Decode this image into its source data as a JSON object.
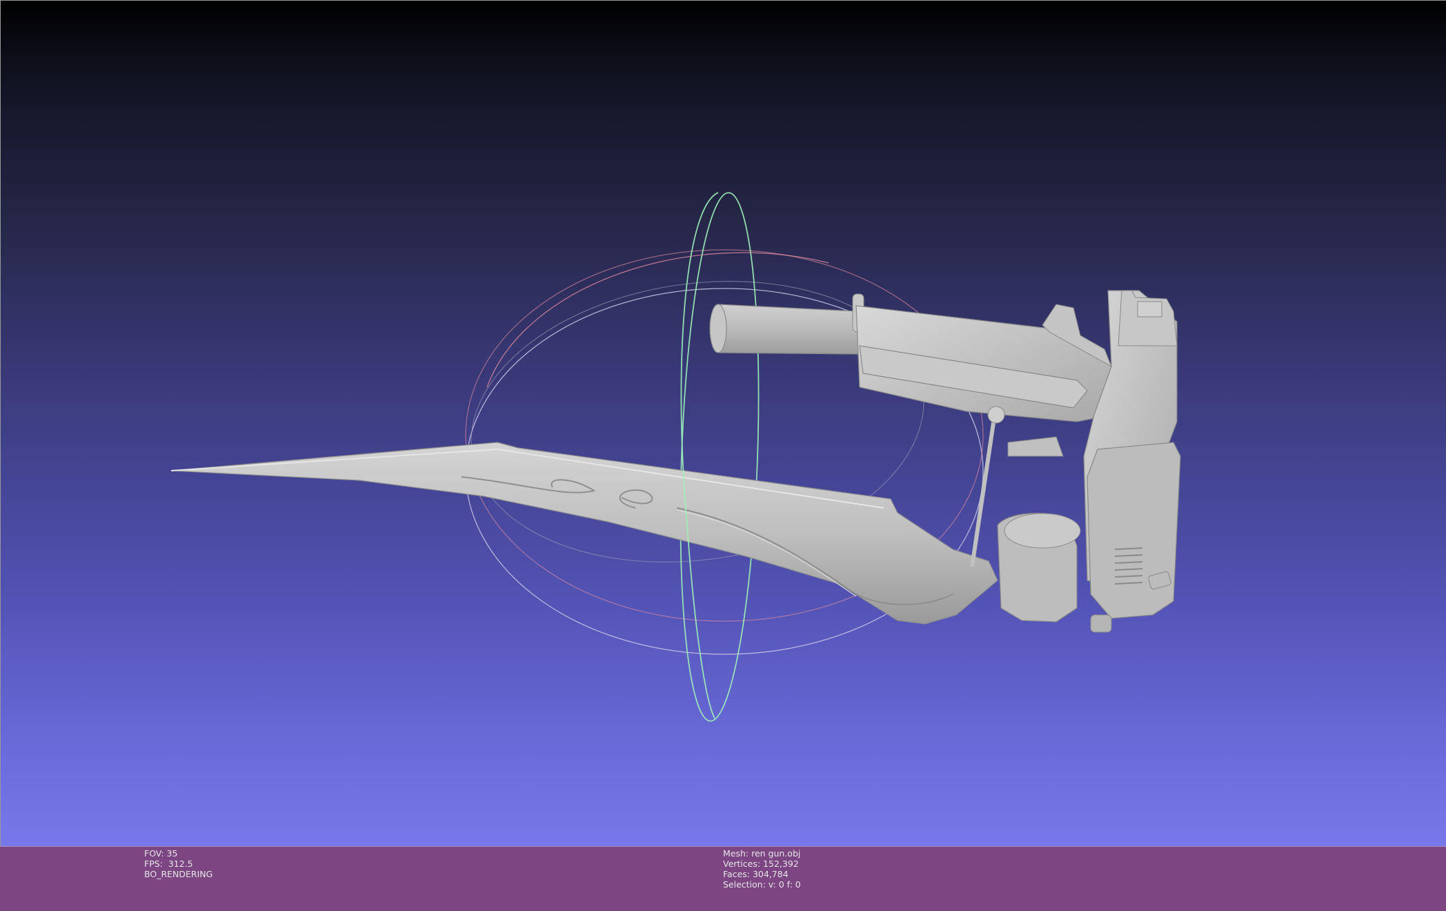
{
  "app": {
    "viewport_label": "3D mesh viewport",
    "colors": {
      "bg_top": "#000000",
      "bg_bottom": "#7878ea",
      "infobar": "#7c4682",
      "mesh": "#bdbdbd",
      "trackball_x": "#e08aa0",
      "trackball_y": "#9cf0b8",
      "trackball_z": "#c8c8e8"
    }
  },
  "scene": {
    "object_icon": "gun-blade-mesh",
    "trackball_icon": "trackball-gizmo"
  },
  "info_left": {
    "fov": "FOV: 35",
    "fps": "FPS:  312.5",
    "mode": "BO_RENDERING"
  },
  "info_right": {
    "mesh": "Mesh: ren gun.obj",
    "vertices": "Vertices: 152,392",
    "faces": "Faces: 304,784",
    "selection": "Selection: v: 0 f: 0"
  }
}
